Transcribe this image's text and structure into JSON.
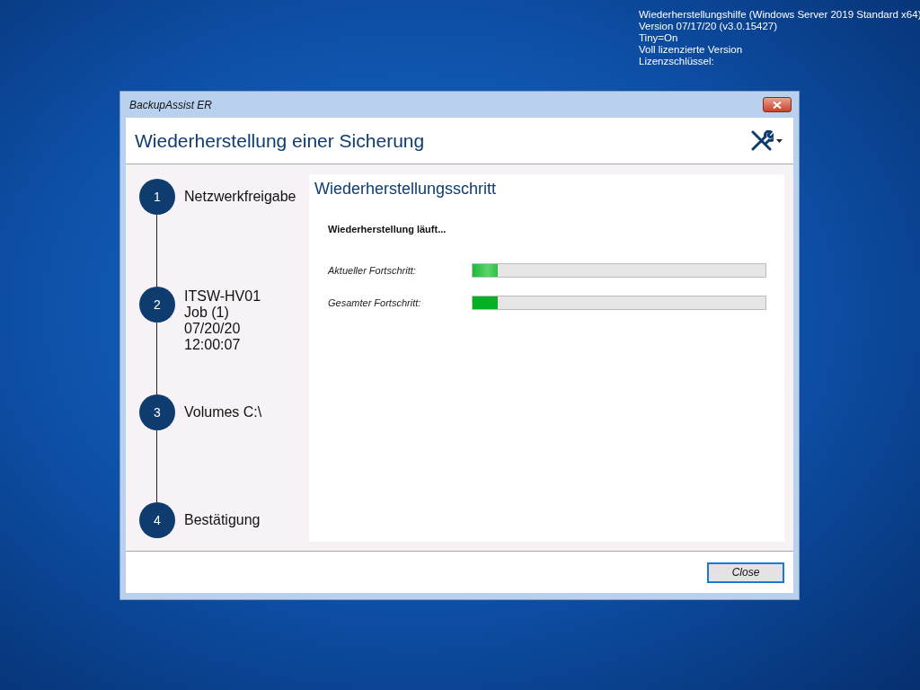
{
  "desktop_info": [
    "Wiederherstellungshilfe (Windows Server 2019 Standard x64)",
    "Version 07/17/20 (v3.0.15427)",
    "Tiny=On",
    "Voll lizenzierte Version",
    "Lizenzschlüssel:"
  ],
  "window": {
    "title": "BackupAssist ER",
    "heading": "Wiederherstellung einer Sicherung"
  },
  "steps": [
    {
      "number": "1",
      "lines": [
        "Netzwerkfreigabe"
      ]
    },
    {
      "number": "2",
      "lines": [
        "ITSW-HV01",
        "Job (1)",
        "07/20/20",
        "12:00:07"
      ]
    },
    {
      "number": "3",
      "lines": [
        "Volumes C:\\"
      ]
    },
    {
      "number": "4",
      "lines": [
        "Bestätigung"
      ]
    }
  ],
  "panel": {
    "title": "Wiederherstellungsschritt",
    "status": "Wiederherstellung läuft...",
    "progress": [
      {
        "label": "Aktueller Fortschritt:",
        "level": 0.085
      },
      {
        "label": "Gesamter Fortschritt:",
        "level": 0.085
      }
    ]
  },
  "buttons": [
    "Close"
  ]
}
